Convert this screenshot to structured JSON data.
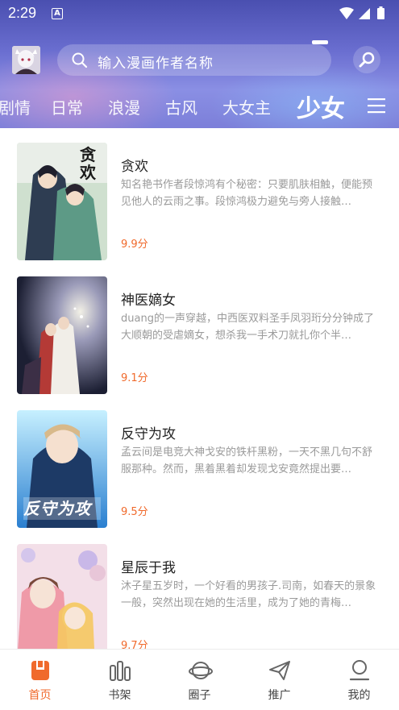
{
  "status": {
    "time": "2:29",
    "notif": "A"
  },
  "search": {
    "placeholder": "输入漫画作者名称"
  },
  "tabs": [
    {
      "label": "剧情",
      "active": false
    },
    {
      "label": "日常",
      "active": false
    },
    {
      "label": "浪漫",
      "active": false
    },
    {
      "label": "古风",
      "active": false
    },
    {
      "label": "大女主",
      "active": false
    },
    {
      "label": "少女",
      "active": true
    }
  ],
  "comics": [
    {
      "title": "贪欢",
      "desc": "知名艳书作者段惊鸿有个秘密：只要肌肤相触，便能预见他人的云雨之事。段惊鸿极力避免与旁人接触…",
      "score": "9.9分",
      "cover_text": "贪欢"
    },
    {
      "title": "神医嫡女",
      "desc": "duang的一声穿越，中西医双料圣手凤羽珩分分钟成了大顺朝的受虐嫡女，想杀我一手术刀就扎你个半…",
      "score": "9.1分",
      "cover_text": ""
    },
    {
      "title": "反守为攻",
      "desc": "孟云间是电竞大神戈安的铁杆黑粉，一天不黑几句不舒服那种。然而，黑着黑着却发现戈安竟然提出要…",
      "score": "9.5分",
      "cover_text": "反守为攻"
    },
    {
      "title": "星辰于我",
      "desc": "沐子星五岁时，一个好看的男孩子.司南，如春天的景象一般，突然出现在她的生活里，成为了她的青梅…",
      "score": "9.7分",
      "cover_text": ""
    }
  ],
  "nav": [
    {
      "label": "首页",
      "icon": "home-icon",
      "active": true
    },
    {
      "label": "书架",
      "icon": "bookshelf-icon",
      "active": false
    },
    {
      "label": "圈子",
      "icon": "planet-icon",
      "active": false
    },
    {
      "label": "推广",
      "icon": "paper-plane-icon",
      "active": false
    },
    {
      "label": "我的",
      "icon": "profile-icon",
      "active": false
    }
  ],
  "colors": {
    "accent": "#f06a2c",
    "header": "#6a6ed0"
  }
}
